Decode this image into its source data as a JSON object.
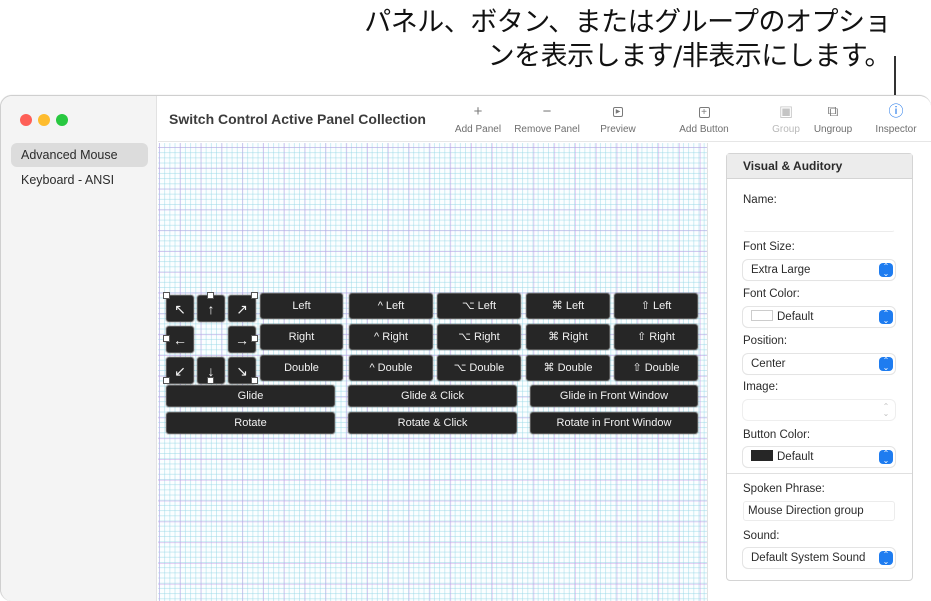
{
  "callout": {
    "text": "パネル、ボタン、またはグループのオプショ\nンを表示します/非表示にします。"
  },
  "window": {
    "title": "Switch Control Active Panel Collection"
  },
  "sidebar": {
    "items": [
      {
        "label": "Advanced Mouse",
        "selected": true
      },
      {
        "label": "Keyboard - ANSI",
        "selected": false
      }
    ]
  },
  "toolbar": {
    "buttons": [
      {
        "label": "Add Panel",
        "icon": "plus-icon",
        "glyph": "+"
      },
      {
        "label": "Remove Panel",
        "icon": "minus-icon",
        "glyph": "−"
      },
      {
        "label": "Preview",
        "icon": "preview-icon",
        "glyph": "▶"
      },
      {
        "label": "Add Button",
        "icon": "add-button-icon",
        "glyph": "+"
      },
      {
        "label": "Group",
        "icon": "group-icon",
        "glyph": "▣",
        "disabled": true
      },
      {
        "label": "Ungroup",
        "icon": "ungroup-icon",
        "glyph": "⧉"
      },
      {
        "label": "Inspector",
        "icon": "info-icon",
        "glyph": "ⓘ",
        "active": true
      }
    ]
  },
  "panel": {
    "arrows": {
      "up_left": "↖",
      "up": "↑",
      "up_right": "↗",
      "left": "←",
      "right": "→",
      "down_left": "↙",
      "down": "↓",
      "down_right": "↘"
    },
    "rows": [
      [
        "Left",
        "^ Left",
        "⌥ Left",
        "⌘ Left",
        "⇧ Left"
      ],
      [
        "Right",
        "^ Right",
        "⌥ Right",
        "⌘ Right",
        "⇧ Right"
      ],
      [
        "Double",
        "^ Double",
        "⌥ Double",
        "⌘ Double",
        "⇧ Double"
      ]
    ],
    "wide_rows": [
      [
        "Glide",
        "Glide & Click",
        "Glide in Front Window"
      ],
      [
        "Rotate",
        "Rotate & Click",
        "Rotate in Front Window"
      ]
    ]
  },
  "inspector": {
    "section_title": "Visual & Auditory",
    "name_label": "Name:",
    "name_value": "",
    "font_size_label": "Font Size:",
    "font_size_value": "Extra Large",
    "font_color_label": "Font Color:",
    "font_color_value": "Default",
    "font_color_swatch": "#ffffff",
    "position_label": "Position:",
    "position_value": "Center",
    "image_label": "Image:",
    "image_value": "",
    "button_color_label": "Button Color:",
    "button_color_value": "Default",
    "button_color_swatch": "#262626",
    "spoken_phrase_label": "Spoken Phrase:",
    "spoken_phrase_value": "Mouse Direction group",
    "sound_label": "Sound:",
    "sound_value": "Default System Sound"
  },
  "colors": {
    "accent": "#1e7cf0",
    "button_bg": "#262626",
    "traffic_red": "#fe5f57",
    "traffic_yellow": "#febc2e",
    "traffic_green": "#28c840"
  }
}
